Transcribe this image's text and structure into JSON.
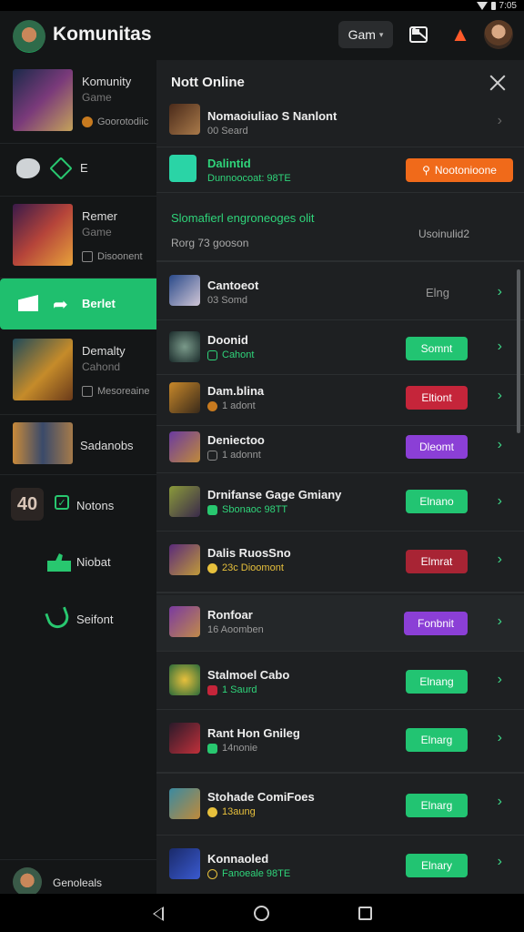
{
  "status_bar": {
    "time": "7:05"
  },
  "app_bar": {
    "title": "Komunitas",
    "game_select": "Gam",
    "icons": [
      "mail-icon",
      "fire-icon",
      "user-avatar"
    ]
  },
  "sidebar": {
    "items": [
      {
        "title": "Komunity",
        "sub": "Game",
        "meta": "Goorotodiic"
      },
      {
        "label": "E"
      },
      {
        "title": "Remer",
        "sub": "Game",
        "meta": "Disoonent"
      },
      {
        "label": "Berlet",
        "active": true
      },
      {
        "title": "Demalty",
        "sub": "Cahond",
        "meta": "Mesoreaine"
      },
      {
        "label": "Sadanobs"
      },
      {
        "label": "Notons"
      },
      {
        "label": "Niobat"
      },
      {
        "label": "Seifont"
      }
    ],
    "footer_label": "Genoleals"
  },
  "panel": {
    "title": "Nott Online",
    "rows": [
      {
        "title": "Nomaoiuliao S Nanlont",
        "sub": "00 Seard",
        "action": ""
      },
      {
        "title": "Dalintid",
        "sub": "Dunnoocoat: 98TE",
        "action": "Nootonioone"
      },
      {
        "title": "Slomafierl engroneoges olit",
        "sub": "Rorg 73 gooson",
        "status": "Usoinulid2"
      },
      {
        "title": "Cantoeot",
        "sub": "03 Somd",
        "status": "Elng"
      },
      {
        "title": "Doonid",
        "sub": "Cahont",
        "action": "Somnt",
        "color": "green"
      },
      {
        "title": "Dam.blina",
        "sub": "1 adont",
        "action": "Eltiont",
        "color": "red"
      },
      {
        "title": "Deniectoo",
        "sub": "1 adonnt",
        "action": "Dleomt",
        "color": "purple"
      },
      {
        "title": "Drnifanse Gage Gmiany",
        "sub": "Sbonaoc 98TT",
        "action": "Elnano",
        "color": "green"
      },
      {
        "title": "Dalis RuosSno",
        "sub": "23c Dioomont",
        "action": "Elmrat",
        "color": "red"
      },
      {
        "title": "Ronfoar",
        "sub": "16 Aoomben",
        "action": "Fonbnit",
        "color": "purple"
      },
      {
        "title": "Stalmoel Cabo",
        "sub": "1 Saurd",
        "action": "Elnang",
        "color": "green"
      },
      {
        "title": "Rant Hon Gnileg",
        "sub": "14nonie",
        "action": "Elnarg",
        "color": "green"
      },
      {
        "title": "Stohade ComiFoes",
        "sub": "13aung",
        "action": "Elnarg",
        "color": "green"
      },
      {
        "title": "Konnaoled",
        "sub": "Fanoeale 98TE",
        "action": "Elnary",
        "color": "green"
      }
    ]
  }
}
